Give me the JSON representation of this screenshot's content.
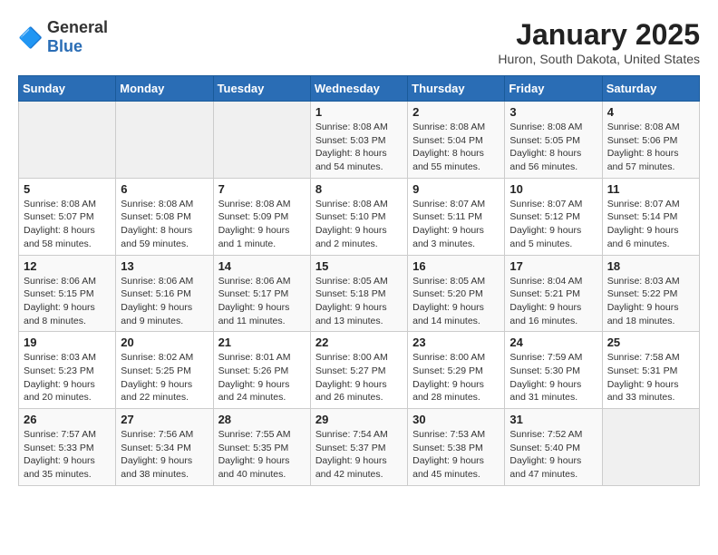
{
  "logo": {
    "text_general": "General",
    "text_blue": "Blue"
  },
  "title": "January 2025",
  "location": "Huron, South Dakota, United States",
  "weekdays": [
    "Sunday",
    "Monday",
    "Tuesday",
    "Wednesday",
    "Thursday",
    "Friday",
    "Saturday"
  ],
  "weeks": [
    [
      {
        "day": "",
        "info": ""
      },
      {
        "day": "",
        "info": ""
      },
      {
        "day": "",
        "info": ""
      },
      {
        "day": "1",
        "info": "Sunrise: 8:08 AM\nSunset: 5:03 PM\nDaylight: 8 hours\nand 54 minutes."
      },
      {
        "day": "2",
        "info": "Sunrise: 8:08 AM\nSunset: 5:04 PM\nDaylight: 8 hours\nand 55 minutes."
      },
      {
        "day": "3",
        "info": "Sunrise: 8:08 AM\nSunset: 5:05 PM\nDaylight: 8 hours\nand 56 minutes."
      },
      {
        "day": "4",
        "info": "Sunrise: 8:08 AM\nSunset: 5:06 PM\nDaylight: 8 hours\nand 57 minutes."
      }
    ],
    [
      {
        "day": "5",
        "info": "Sunrise: 8:08 AM\nSunset: 5:07 PM\nDaylight: 8 hours\nand 58 minutes."
      },
      {
        "day": "6",
        "info": "Sunrise: 8:08 AM\nSunset: 5:08 PM\nDaylight: 8 hours\nand 59 minutes."
      },
      {
        "day": "7",
        "info": "Sunrise: 8:08 AM\nSunset: 5:09 PM\nDaylight: 9 hours\nand 1 minute."
      },
      {
        "day": "8",
        "info": "Sunrise: 8:08 AM\nSunset: 5:10 PM\nDaylight: 9 hours\nand 2 minutes."
      },
      {
        "day": "9",
        "info": "Sunrise: 8:07 AM\nSunset: 5:11 PM\nDaylight: 9 hours\nand 3 minutes."
      },
      {
        "day": "10",
        "info": "Sunrise: 8:07 AM\nSunset: 5:12 PM\nDaylight: 9 hours\nand 5 minutes."
      },
      {
        "day": "11",
        "info": "Sunrise: 8:07 AM\nSunset: 5:14 PM\nDaylight: 9 hours\nand 6 minutes."
      }
    ],
    [
      {
        "day": "12",
        "info": "Sunrise: 8:06 AM\nSunset: 5:15 PM\nDaylight: 9 hours\nand 8 minutes."
      },
      {
        "day": "13",
        "info": "Sunrise: 8:06 AM\nSunset: 5:16 PM\nDaylight: 9 hours\nand 9 minutes."
      },
      {
        "day": "14",
        "info": "Sunrise: 8:06 AM\nSunset: 5:17 PM\nDaylight: 9 hours\nand 11 minutes."
      },
      {
        "day": "15",
        "info": "Sunrise: 8:05 AM\nSunset: 5:18 PM\nDaylight: 9 hours\nand 13 minutes."
      },
      {
        "day": "16",
        "info": "Sunrise: 8:05 AM\nSunset: 5:20 PM\nDaylight: 9 hours\nand 14 minutes."
      },
      {
        "day": "17",
        "info": "Sunrise: 8:04 AM\nSunset: 5:21 PM\nDaylight: 9 hours\nand 16 minutes."
      },
      {
        "day": "18",
        "info": "Sunrise: 8:03 AM\nSunset: 5:22 PM\nDaylight: 9 hours\nand 18 minutes."
      }
    ],
    [
      {
        "day": "19",
        "info": "Sunrise: 8:03 AM\nSunset: 5:23 PM\nDaylight: 9 hours\nand 20 minutes."
      },
      {
        "day": "20",
        "info": "Sunrise: 8:02 AM\nSunset: 5:25 PM\nDaylight: 9 hours\nand 22 minutes."
      },
      {
        "day": "21",
        "info": "Sunrise: 8:01 AM\nSunset: 5:26 PM\nDaylight: 9 hours\nand 24 minutes."
      },
      {
        "day": "22",
        "info": "Sunrise: 8:00 AM\nSunset: 5:27 PM\nDaylight: 9 hours\nand 26 minutes."
      },
      {
        "day": "23",
        "info": "Sunrise: 8:00 AM\nSunset: 5:29 PM\nDaylight: 9 hours\nand 28 minutes."
      },
      {
        "day": "24",
        "info": "Sunrise: 7:59 AM\nSunset: 5:30 PM\nDaylight: 9 hours\nand 31 minutes."
      },
      {
        "day": "25",
        "info": "Sunrise: 7:58 AM\nSunset: 5:31 PM\nDaylight: 9 hours\nand 33 minutes."
      }
    ],
    [
      {
        "day": "26",
        "info": "Sunrise: 7:57 AM\nSunset: 5:33 PM\nDaylight: 9 hours\nand 35 minutes."
      },
      {
        "day": "27",
        "info": "Sunrise: 7:56 AM\nSunset: 5:34 PM\nDaylight: 9 hours\nand 38 minutes."
      },
      {
        "day": "28",
        "info": "Sunrise: 7:55 AM\nSunset: 5:35 PM\nDaylight: 9 hours\nand 40 minutes."
      },
      {
        "day": "29",
        "info": "Sunrise: 7:54 AM\nSunset: 5:37 PM\nDaylight: 9 hours\nand 42 minutes."
      },
      {
        "day": "30",
        "info": "Sunrise: 7:53 AM\nSunset: 5:38 PM\nDaylight: 9 hours\nand 45 minutes."
      },
      {
        "day": "31",
        "info": "Sunrise: 7:52 AM\nSunset: 5:40 PM\nDaylight: 9 hours\nand 47 minutes."
      },
      {
        "day": "",
        "info": ""
      }
    ]
  ]
}
